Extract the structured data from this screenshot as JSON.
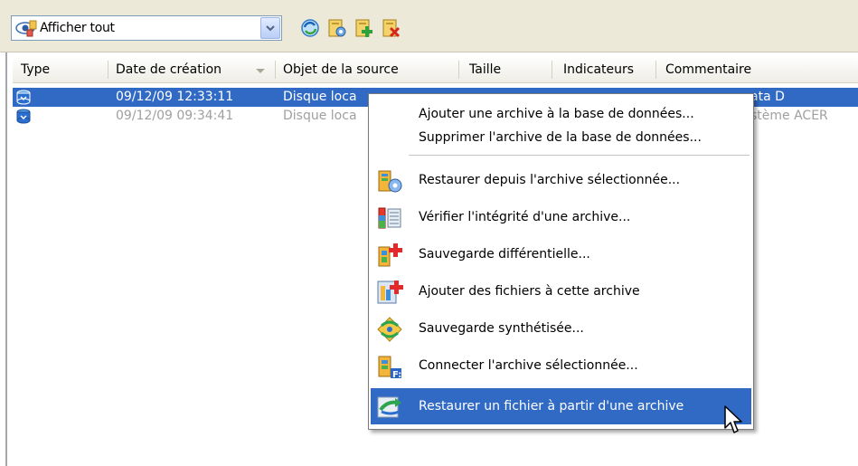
{
  "toolbar": {
    "filter_value": "Afficher tout",
    "buttons": [
      "refresh-icon",
      "archive-settings-icon",
      "add-archive-icon",
      "delete-archive-icon"
    ]
  },
  "table": {
    "columns": [
      "Type",
      "Date de création",
      "Objet de la source",
      "Taille",
      "Indicateurs",
      "Commentaire"
    ],
    "rows": [
      {
        "date": "09/12/09 12:33:11",
        "source": "Disque loca",
        "comment": "ata D",
        "selected": true
      },
      {
        "date": "09/12/09 09:34:41",
        "source": "Disque loca",
        "comment": "stème ACER",
        "selected": false
      }
    ]
  },
  "context_menu": {
    "items": [
      {
        "label": "Ajouter une archive à la base de données...",
        "icon": ""
      },
      {
        "label": "Supprimer l'archive de la base de données...",
        "icon": ""
      },
      {
        "label": "Restaurer depuis l'archive sélectionnée...",
        "icon": "restore-archive-icon"
      },
      {
        "label": "Vérifier l'intégrité d'une archive...",
        "icon": "verify-archive-icon"
      },
      {
        "label": "Sauvegarde différentielle...",
        "icon": "differential-backup-icon"
      },
      {
        "label": "Ajouter des fichiers à cette archive",
        "icon": "add-files-icon"
      },
      {
        "label": "Sauvegarde synthétisée...",
        "icon": "synthetic-backup-icon"
      },
      {
        "label": "Connecter l'archive sélectionnée...",
        "icon": "mount-archive-icon"
      },
      {
        "label": "Restaurer un fichier à partir d'une archive",
        "icon": "restore-file-icon"
      }
    ],
    "highlighted_index": 8
  },
  "colors": {
    "selection": "#316ac5",
    "toolbar_bg": "#ece9d8",
    "dim_text": "#a0a0a0"
  }
}
